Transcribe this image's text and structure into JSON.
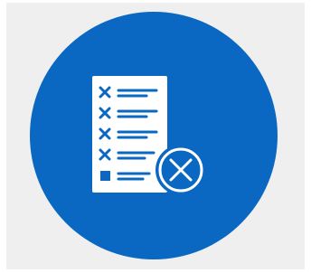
{
  "icon": {
    "name": "checklist-cancel-icon",
    "background_color": "#efefef",
    "circle_color": "#0a68c2",
    "glyph_color": "#ffffff",
    "items": [
      {
        "mark": "x-mark"
      },
      {
        "mark": "x-mark"
      },
      {
        "mark": "x-mark"
      },
      {
        "mark": "x-mark"
      },
      {
        "mark": "filled-square"
      }
    ],
    "badge": "cancel-circle-icon"
  }
}
